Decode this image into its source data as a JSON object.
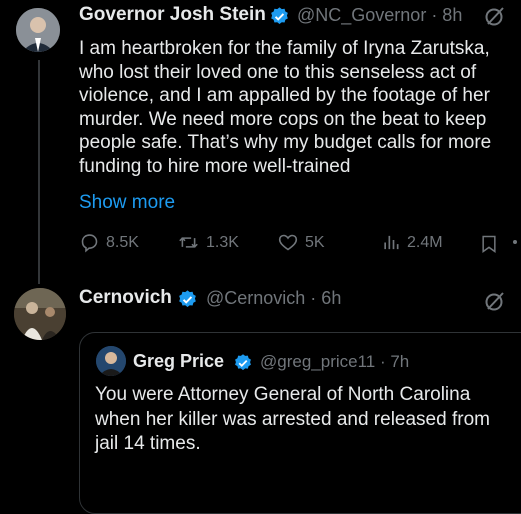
{
  "colors": {
    "background": "#000000",
    "text": "#e7e9ea",
    "muted": "#71767b",
    "link": "#1d9bf0",
    "verified": "#1d9bf0"
  },
  "tweet": {
    "author_name": "Governor Josh Stein",
    "meta": "@NC_Governor · 8h",
    "body": "I am heartbroken for the family of Iryna Zarutska, who lost their loved one to this senseless act of violence, and I am appalled by the footage of her murder. We need more cops on the beat to keep people safe. That’s why my budget calls for more funding to hire more well-trained",
    "show_more": "Show more",
    "actions": {
      "replies": "8.5K",
      "reposts": "1.3K",
      "likes": "5K",
      "views": "2.4M"
    }
  },
  "reply": {
    "author_name": "Cernovich",
    "meta": "@Cernovich · 6h",
    "quote": {
      "author_name": "Greg Price",
      "meta": "@greg_price11 · 7h",
      "body": "You were Attorney General of North Carolina when her killer was arrested and released from jail 14 times."
    }
  },
  "icons": [
    "grok-icon",
    "reply-icon",
    "repost-icon",
    "like-icon",
    "views-icon",
    "bookmark-icon",
    "verified-badge-icon"
  ]
}
